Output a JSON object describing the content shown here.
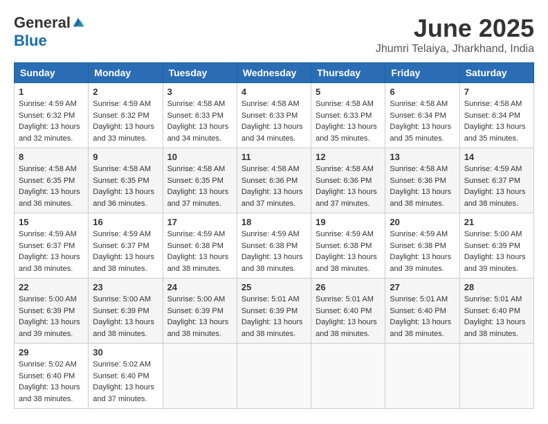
{
  "logo": {
    "general": "General",
    "blue": "Blue"
  },
  "title": "June 2025",
  "location": "Jhumri Telaiya, Jharkhand, India",
  "days_of_week": [
    "Sunday",
    "Monday",
    "Tuesday",
    "Wednesday",
    "Thursday",
    "Friday",
    "Saturday"
  ],
  "weeks": [
    [
      {
        "day": "1",
        "sunrise": "4:59 AM",
        "sunset": "6:32 PM",
        "daylight": "13 hours and 32 minutes."
      },
      {
        "day": "2",
        "sunrise": "4:59 AM",
        "sunset": "6:32 PM",
        "daylight": "13 hours and 33 minutes."
      },
      {
        "day": "3",
        "sunrise": "4:58 AM",
        "sunset": "6:33 PM",
        "daylight": "13 hours and 34 minutes."
      },
      {
        "day": "4",
        "sunrise": "4:58 AM",
        "sunset": "6:33 PM",
        "daylight": "13 hours and 34 minutes."
      },
      {
        "day": "5",
        "sunrise": "4:58 AM",
        "sunset": "6:33 PM",
        "daylight": "13 hours and 35 minutes."
      },
      {
        "day": "6",
        "sunrise": "4:58 AM",
        "sunset": "6:34 PM",
        "daylight": "13 hours and 35 minutes."
      },
      {
        "day": "7",
        "sunrise": "4:58 AM",
        "sunset": "6:34 PM",
        "daylight": "13 hours and 35 minutes."
      }
    ],
    [
      {
        "day": "8",
        "sunrise": "4:58 AM",
        "sunset": "6:35 PM",
        "daylight": "13 hours and 36 minutes."
      },
      {
        "day": "9",
        "sunrise": "4:58 AM",
        "sunset": "6:35 PM",
        "daylight": "13 hours and 36 minutes."
      },
      {
        "day": "10",
        "sunrise": "4:58 AM",
        "sunset": "6:35 PM",
        "daylight": "13 hours and 37 minutes."
      },
      {
        "day": "11",
        "sunrise": "4:58 AM",
        "sunset": "6:36 PM",
        "daylight": "13 hours and 37 minutes."
      },
      {
        "day": "12",
        "sunrise": "4:58 AM",
        "sunset": "6:36 PM",
        "daylight": "13 hours and 37 minutes."
      },
      {
        "day": "13",
        "sunrise": "4:58 AM",
        "sunset": "6:36 PM",
        "daylight": "13 hours and 38 minutes."
      },
      {
        "day": "14",
        "sunrise": "4:59 AM",
        "sunset": "6:37 PM",
        "daylight": "13 hours and 38 minutes."
      }
    ],
    [
      {
        "day": "15",
        "sunrise": "4:59 AM",
        "sunset": "6:37 PM",
        "daylight": "13 hours and 38 minutes."
      },
      {
        "day": "16",
        "sunrise": "4:59 AM",
        "sunset": "6:37 PM",
        "daylight": "13 hours and 38 minutes."
      },
      {
        "day": "17",
        "sunrise": "4:59 AM",
        "sunset": "6:38 PM",
        "daylight": "13 hours and 38 minutes."
      },
      {
        "day": "18",
        "sunrise": "4:59 AM",
        "sunset": "6:38 PM",
        "daylight": "13 hours and 38 minutes."
      },
      {
        "day": "19",
        "sunrise": "4:59 AM",
        "sunset": "6:38 PM",
        "daylight": "13 hours and 38 minutes."
      },
      {
        "day": "20",
        "sunrise": "4:59 AM",
        "sunset": "6:38 PM",
        "daylight": "13 hours and 39 minutes."
      },
      {
        "day": "21",
        "sunrise": "5:00 AM",
        "sunset": "6:39 PM",
        "daylight": "13 hours and 39 minutes."
      }
    ],
    [
      {
        "day": "22",
        "sunrise": "5:00 AM",
        "sunset": "6:39 PM",
        "daylight": "13 hours and 39 minutes."
      },
      {
        "day": "23",
        "sunrise": "5:00 AM",
        "sunset": "6:39 PM",
        "daylight": "13 hours and 38 minutes."
      },
      {
        "day": "24",
        "sunrise": "5:00 AM",
        "sunset": "6:39 PM",
        "daylight": "13 hours and 38 minutes."
      },
      {
        "day": "25",
        "sunrise": "5:01 AM",
        "sunset": "6:39 PM",
        "daylight": "13 hours and 38 minutes."
      },
      {
        "day": "26",
        "sunrise": "5:01 AM",
        "sunset": "6:40 PM",
        "daylight": "13 hours and 38 minutes."
      },
      {
        "day": "27",
        "sunrise": "5:01 AM",
        "sunset": "6:40 PM",
        "daylight": "13 hours and 38 minutes."
      },
      {
        "day": "28",
        "sunrise": "5:01 AM",
        "sunset": "6:40 PM",
        "daylight": "13 hours and 38 minutes."
      }
    ],
    [
      {
        "day": "29",
        "sunrise": "5:02 AM",
        "sunset": "6:40 PM",
        "daylight": "13 hours and 38 minutes."
      },
      {
        "day": "30",
        "sunrise": "5:02 AM",
        "sunset": "6:40 PM",
        "daylight": "13 hours and 37 minutes."
      },
      null,
      null,
      null,
      null,
      null
    ]
  ]
}
